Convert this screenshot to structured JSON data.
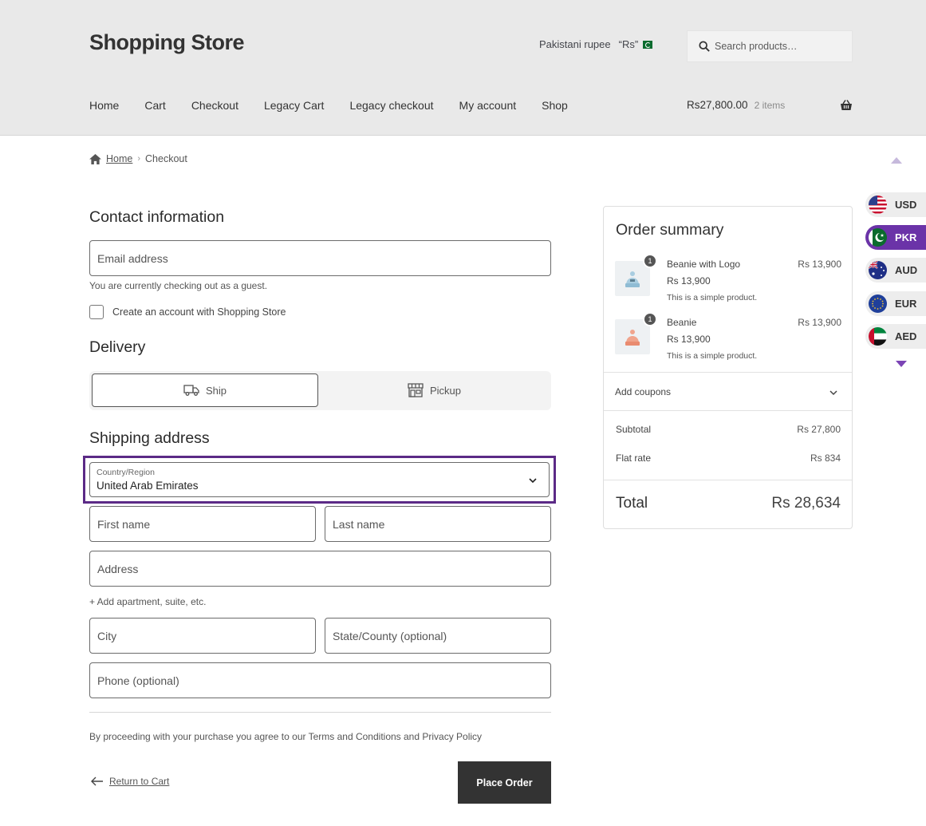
{
  "header": {
    "site_title": "Shopping Store",
    "currency_name": "Pakistani rupee",
    "currency_symbol": "“Rs”",
    "search_placeholder": "Search products…",
    "nav": [
      "Home",
      "Cart",
      "Checkout",
      "Legacy Cart",
      "Legacy checkout",
      "My account",
      "Shop"
    ],
    "cart_total": "Rs27,800.00",
    "cart_count": "2 items"
  },
  "breadcrumb": {
    "home": "Home",
    "current": "Checkout"
  },
  "contact": {
    "heading": "Contact information",
    "email_placeholder": "Email address",
    "guest_note": "You are currently checking out as a guest.",
    "create_account_label": "Create an account with Shopping Store"
  },
  "delivery": {
    "heading": "Delivery",
    "ship_label": "Ship",
    "pickup_label": "Pickup"
  },
  "shipping": {
    "heading": "Shipping address",
    "country_label": "Country/Region",
    "country_value": "United Arab Emirates",
    "first_name_placeholder": "First name",
    "last_name_placeholder": "Last name",
    "address_placeholder": "Address",
    "add_apartment": "+ Add apartment, suite, etc.",
    "city_placeholder": "City",
    "state_placeholder": "State/County (optional)",
    "phone_placeholder": "Phone (optional)"
  },
  "footer": {
    "terms": "By proceeding with your purchase you agree to our Terms and Conditions and Privacy Policy",
    "return_link": "Return to Cart",
    "place_order": "Place Order"
  },
  "summary": {
    "title": "Order summary",
    "items": [
      {
        "qty": "1",
        "name": "Beanie with Logo",
        "price": "Rs 13,900",
        "description": "This is a simple product.",
        "line_total": "Rs 13,900",
        "color": "#a9cde0"
      },
      {
        "qty": "1",
        "name": "Beanie",
        "price": "Rs 13,900",
        "description": "This is a simple product.",
        "line_total": "Rs 13,900",
        "color": "#f0a48c"
      }
    ],
    "coupons_label": "Add coupons",
    "subtotal_label": "Subtotal",
    "subtotal_value": "Rs 27,800",
    "shipping_label": "Flat rate",
    "shipping_value": "Rs 834",
    "total_label": "Total",
    "total_value": "Rs 28,634"
  },
  "currency_switcher": {
    "options": [
      "USD",
      "PKR",
      "AUD",
      "EUR",
      "AED"
    ],
    "active": "PKR",
    "accent": "#6b33a8"
  }
}
